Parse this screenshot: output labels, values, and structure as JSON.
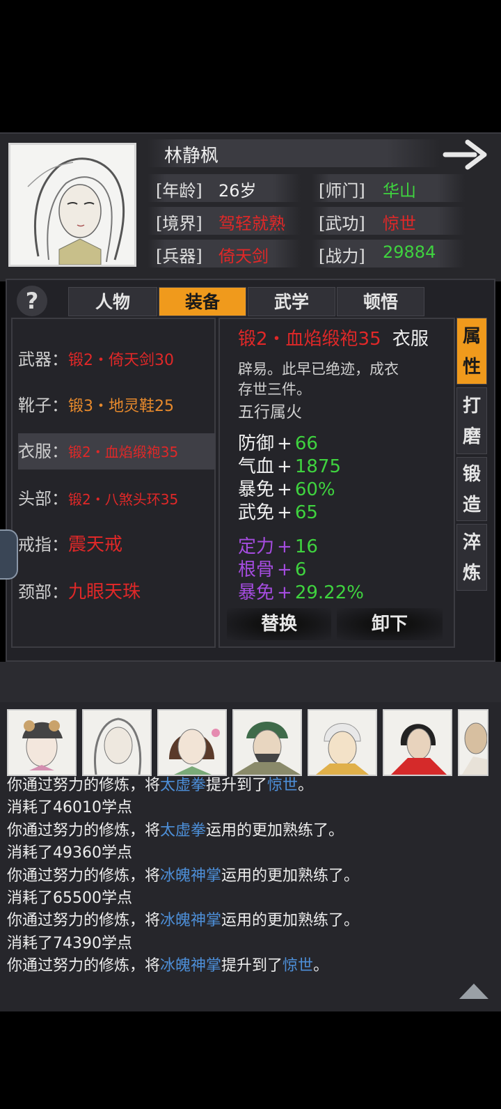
{
  "header": {
    "name": "林静枫",
    "age_label": "[年龄]",
    "age": "26岁",
    "sect_label": "[师门]",
    "sect": "华山",
    "realm_label": "[境界]",
    "realm": "驾轻就熟",
    "martial_label": "[武功]",
    "martial": "惊世",
    "weapon_label": "[兵器]",
    "weapon": "倚天剑",
    "power_label": "[战力]",
    "power": "29884"
  },
  "help": "?",
  "tabs": [
    {
      "label": "人物",
      "active": false
    },
    {
      "label": "装备",
      "active": true
    },
    {
      "label": "武学",
      "active": false
    },
    {
      "label": "顿悟",
      "active": false
    }
  ],
  "equipment": [
    {
      "slot": "武器：",
      "item": "锻2・倚天剑30",
      "color": "#e02828"
    },
    {
      "slot": "靴子：",
      "item": "锻3・地灵鞋25",
      "color": "#e88a2c"
    },
    {
      "slot": "衣服：",
      "item": "锻2・血焰缎袍35",
      "color": "#e02828",
      "selected": true
    },
    {
      "slot": "头部：",
      "item": "锻2・八煞头环35",
      "color": "#e02828"
    },
    {
      "slot": "戒指：",
      "item": "震天戒",
      "color": "#e02828"
    },
    {
      "slot": "颈部：",
      "item": "九眼天珠",
      "color": "#e02828"
    }
  ],
  "detail": {
    "item_name": "锻2・血焰缎袍35",
    "item_type": "衣服",
    "desc_line1": "辟易。此早已绝迹，成衣",
    "desc_line2": "存世三件。",
    "element": "五行属火",
    "base_stats": [
      {
        "name": "防御",
        "value": "66"
      },
      {
        "name": "气血",
        "value": "1875"
      },
      {
        "name": "暴免",
        "value": "60%"
      },
      {
        "name": "武免",
        "value": "65"
      }
    ],
    "bonus_stats": [
      {
        "name": "定力",
        "value": "16"
      },
      {
        "name": "根骨",
        "value": "6"
      },
      {
        "name": "暴免",
        "value": "29.22%"
      }
    ],
    "replace_label": "替换",
    "unequip_label": "卸下"
  },
  "side_tabs": [
    {
      "label": "属性",
      "active": true
    },
    {
      "label": "打磨",
      "active": false
    },
    {
      "label": "锻造",
      "active": false
    },
    {
      "label": "淬炼",
      "active": false
    }
  ],
  "log": {
    "line1": {
      "a": "你通过努力的修炼，将",
      "b": "太虚拳",
      "c": "提升到了",
      "d": "惊世",
      "e": "。"
    },
    "line2": "消耗了46010学点",
    "line3": {
      "a": "你通过努力的修炼，将",
      "b": "太虚拳",
      "c": "运用的更加熟练了。"
    },
    "line4": "消耗了49360学点",
    "line5": {
      "a": "你通过努力的修炼，将",
      "b": "冰魄神掌",
      "c": "运用的更加熟练了。"
    },
    "line6": "消耗了65500学点",
    "line7": {
      "a": "你通过努力的修炼，将",
      "b": "冰魄神掌",
      "c": "运用的更加熟练了。"
    },
    "line8": "消耗了74390学点",
    "line9": {
      "a": "你通过努力的修炼，将",
      "b": "冰魄神掌",
      "c": "提升到了",
      "d": "惊世",
      "e": "。"
    }
  }
}
